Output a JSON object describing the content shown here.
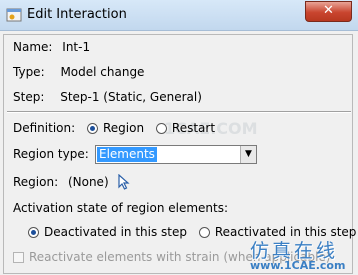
{
  "window": {
    "title": "Edit Interaction",
    "close_glyph": "✕"
  },
  "fields": {
    "name_label": "Name:",
    "name_value": "Int-1",
    "type_label": "Type:",
    "type_value": "Model change",
    "step_label": "Step:",
    "step_value": "Step-1 (Static, General)"
  },
  "definition": {
    "label": "Definition:",
    "options": [
      "Region",
      "Restart"
    ],
    "selected": "Region"
  },
  "region_type": {
    "label": "Region type:",
    "value": "Elements",
    "arrow": "▼"
  },
  "region": {
    "label": "Region:",
    "value": "(None)"
  },
  "activation": {
    "label": "Activation state of region elements:",
    "options": [
      "Deactivated in this step",
      "Reactivated in this step"
    ],
    "selected": "Deactivated in this step"
  },
  "reactivate_strain": {
    "label": "Reactivate elements with strain (when applicable)",
    "enabled": false,
    "checked": false
  },
  "watermark": {
    "chinese": "仿真在线",
    "url": "www.1CAE.com",
    "faint": "1CAE.COM"
  },
  "colors": {
    "accent": "#3399ff",
    "watermark": "#3a7fc4",
    "close": "#c9452f"
  }
}
